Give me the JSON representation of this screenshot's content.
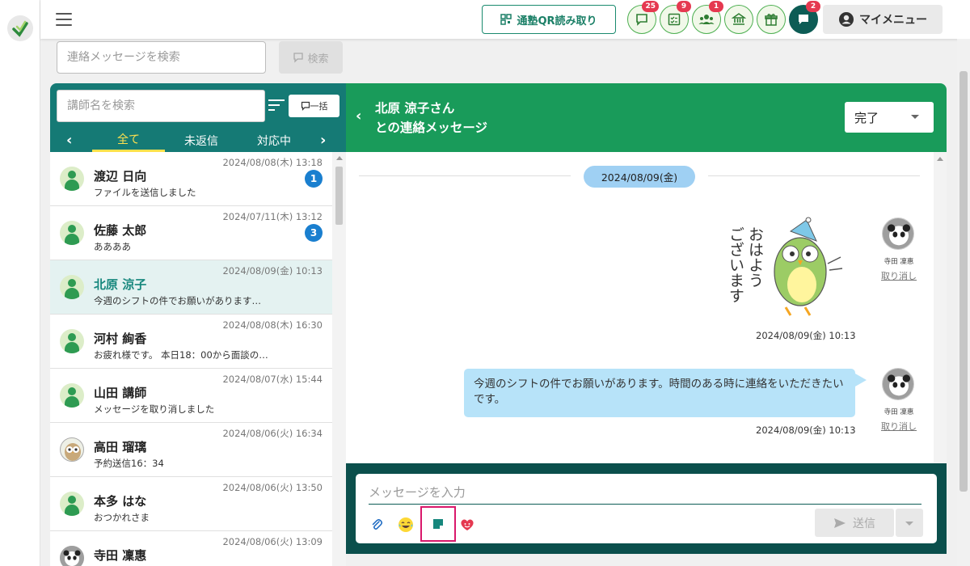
{
  "header": {
    "qr_label": "通塾QR読み取り",
    "badges": {
      "messages": "25",
      "tasks": "9",
      "students": "1",
      "chat": "2"
    },
    "mymenu_label": "マイメニュー"
  },
  "message_search": {
    "placeholder": "連絡メッセージを検索",
    "button": "検索"
  },
  "teacher_panel": {
    "search_placeholder": "講師名を検索",
    "bulk_label": "一括",
    "tabs": [
      "全て",
      "未返信",
      "対応中"
    ],
    "items": [
      {
        "name": "渡辺 日向",
        "date": "2024/08/08(木) 13:18",
        "preview": "ファイルを送信しました",
        "unread": "1"
      },
      {
        "name": "佐藤 太郎",
        "date": "2024/07/11(木) 13:12",
        "preview": "ああああ",
        "unread": "3"
      },
      {
        "name": "北原 涼子",
        "date": "2024/08/09(金) 10:13",
        "preview": "今週のシフトの件でお願いがあります…",
        "unread": ""
      },
      {
        "name": "河村 絢香",
        "date": "2024/08/08(木) 16:30",
        "preview": "お疲れ様です。 本日18：00から面談の…",
        "unread": ""
      },
      {
        "name": "山田 講師",
        "date": "2024/08/07(水) 15:44",
        "preview": "メッセージを取り消しました",
        "unread": ""
      },
      {
        "name": "高田 瑠璃",
        "date": "2024/08/06(火) 16:34",
        "preview": "予約送信16：34",
        "unread": ""
      },
      {
        "name": "本多 はな",
        "date": "2024/08/06(火) 13:50",
        "preview": "おつかれさま",
        "unread": ""
      },
      {
        "name": "寺田 凜惠",
        "date": "2024/08/06(火) 13:09",
        "preview": "",
        "unread": ""
      }
    ]
  },
  "chat": {
    "title_line1": "北原 涼子さん",
    "title_line2": "との連絡メッセージ",
    "status": "完了",
    "date_divider": "2024/08/09(金)",
    "stamp_text": [
      "おはよう",
      "ございます"
    ],
    "messages": [
      {
        "sender": "寺田 凜惠",
        "time": "2024/08/09(金) 10:13",
        "cancel": "取り消し"
      },
      {
        "sender": "寺田 凜惠",
        "time": "2024/08/09(金) 10:13",
        "cancel": "取り消し",
        "text": "今週のシフトの件でお願いがあります。時間のある時に連絡をいただきたいです。"
      }
    ],
    "input_placeholder": "メッセージを入力",
    "send_label": "送信"
  },
  "colors": {
    "teal_dark": "#157a75",
    "green_header": "#199b5a",
    "composer": "#0b4f4c",
    "bubble": "#b7e3f9",
    "badge_red": "#e53950"
  }
}
